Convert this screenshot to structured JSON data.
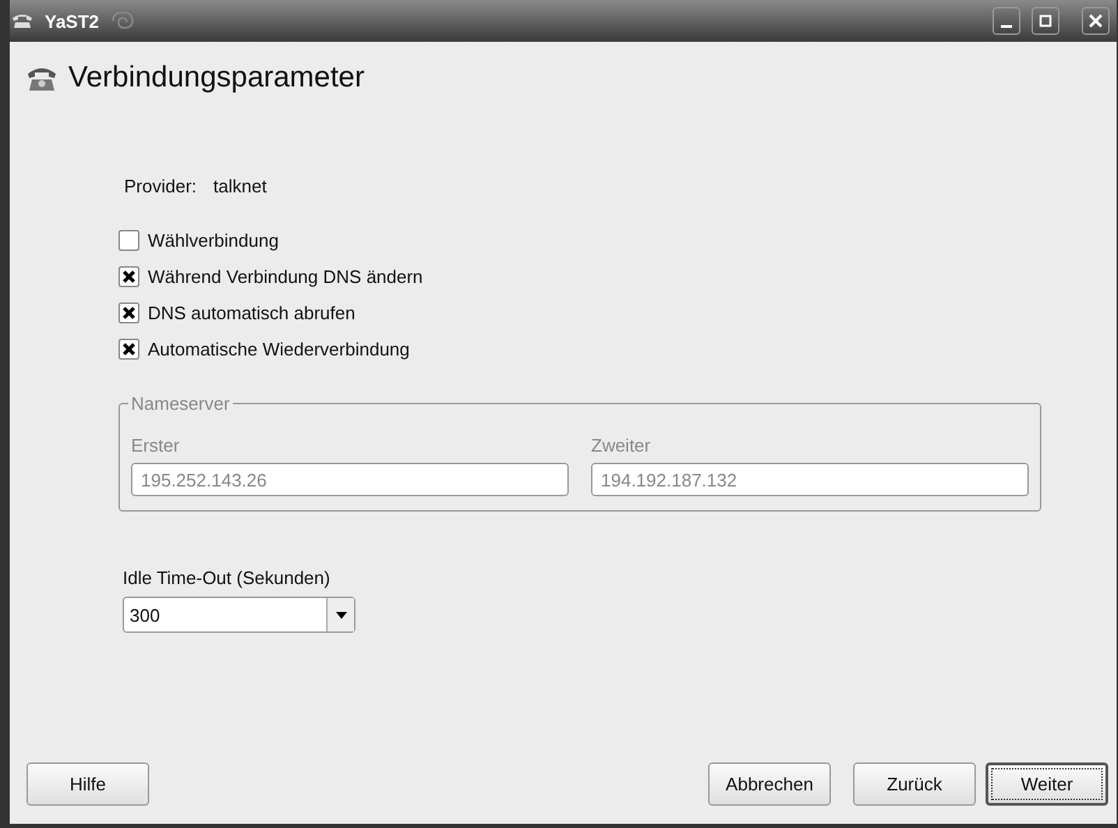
{
  "window": {
    "title": "YaST2"
  },
  "heading": "Verbindungsparameter",
  "provider": {
    "label": "Provider:",
    "value": "talknet"
  },
  "options": [
    {
      "label": "Wählverbindung",
      "checked": false
    },
    {
      "label": "Während Verbindung DNS ändern",
      "checked": true
    },
    {
      "label": "DNS automatisch abrufen",
      "checked": true
    },
    {
      "label": "Automatische Wiederverbindung",
      "checked": true
    }
  ],
  "nameserver": {
    "title": "Nameserver",
    "disabled": true,
    "fields": [
      {
        "label": "Erster",
        "value": "195.252.143.26"
      },
      {
        "label": "Zweiter",
        "value": "194.192.187.132"
      }
    ]
  },
  "idle_timeout": {
    "label": "Idle Time-Out (Sekunden)",
    "value": "300"
  },
  "buttons": [
    {
      "label": "Hilfe",
      "default": false
    },
    {
      "label": "Abbrechen",
      "default": false
    },
    {
      "label": "Zurück",
      "default": false
    },
    {
      "label": "Weiter",
      "default": true
    }
  ]
}
